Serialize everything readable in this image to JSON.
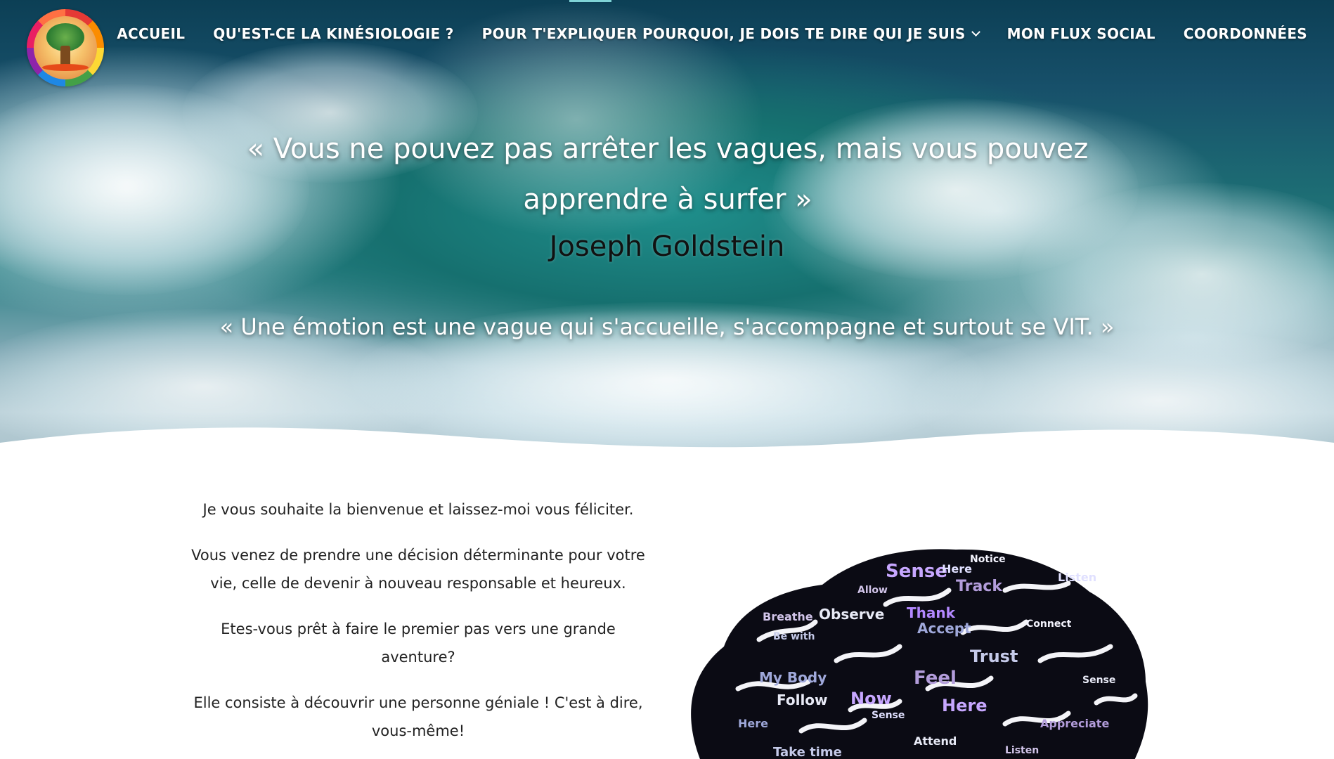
{
  "nav": {
    "logo_alt": "Kinésiologie logo",
    "items": [
      {
        "label": "ACCUEIL",
        "has_dropdown": false
      },
      {
        "label": "QU'EST-CE LA KINÉSIOLOGIE ?",
        "has_dropdown": false
      },
      {
        "label": "POUR T'EXPLIQUER POURQUOI, JE DOIS TE DIRE QUI JE SUIS",
        "has_dropdown": true
      },
      {
        "label": "MON FLUX SOCIAL",
        "has_dropdown": false
      },
      {
        "label": "COORDONNÉES",
        "has_dropdown": false
      }
    ]
  },
  "hero": {
    "quote_line1": "« Vous ne pouvez pas arrêter les vagues, mais vous pouvez",
    "quote_line2": "apprendre à surfer »",
    "author": "Joseph Goldstein",
    "quote2": "« Une émotion est une vague qui s'accueille, s'accompagne et surtout se VIT. »"
  },
  "content": {
    "p1": "Je vous souhaite la bienvenue et laissez-moi vous féliciter.",
    "p2": "Vous venez de prendre une décision déterminante pour votre vie, celle de devenir à nouveau responsable et heureux.",
    "p3": "Etes-vous prêt à faire le premier  pas vers une grande aventure?",
    "p4": "Elle consiste à découvrir une personne géniale ! C'est à dire, vous-même!"
  },
  "brain_words": [
    "Sense",
    "Track",
    "Here",
    "Notice",
    "Trust",
    "Accept",
    "Thank",
    "Observe",
    "Breathe",
    "Be with",
    "Feel",
    "My Body",
    "Follow",
    "Now",
    "Listen",
    "Allow",
    "Take time",
    "Attend",
    "Appreciate",
    "Connect"
  ],
  "colors": {
    "nav_text": "#ffffff",
    "hero_text": "#ffffff",
    "author_text": "#111111",
    "body_text": "#222222",
    "accent": "#7fd3d6"
  }
}
